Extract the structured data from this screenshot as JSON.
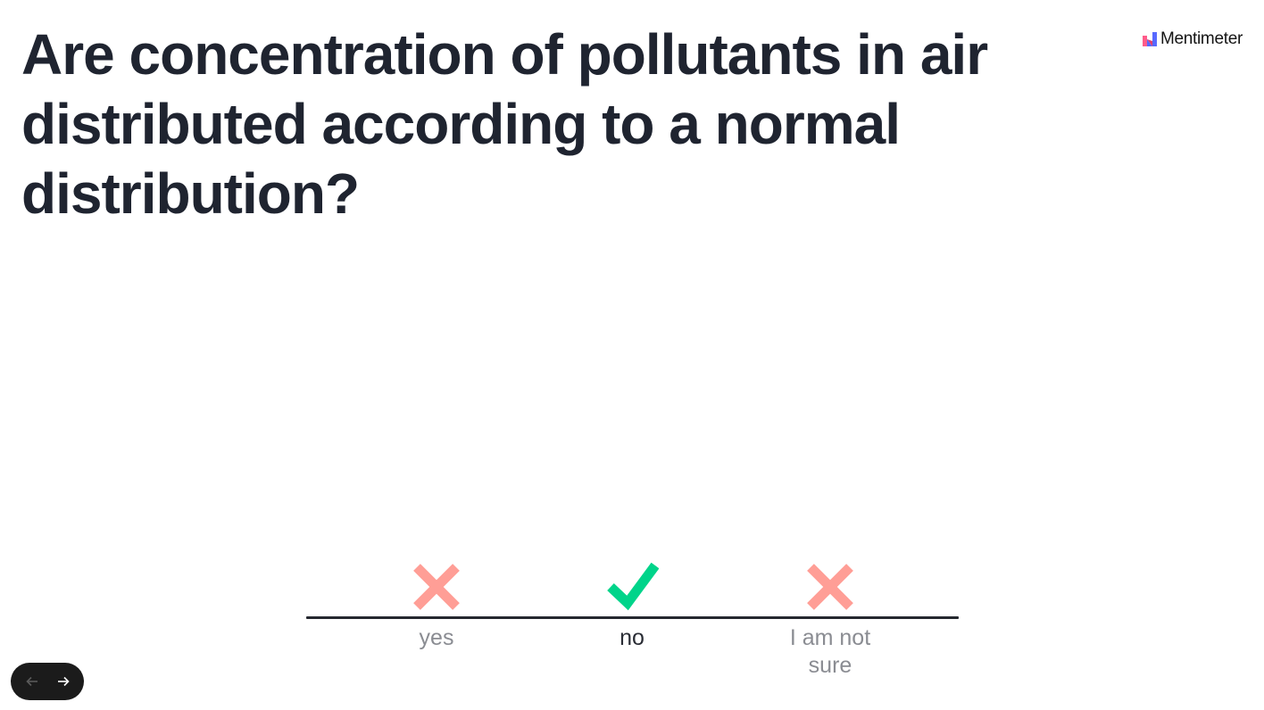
{
  "slide": {
    "question": "Are concentration of pollutants in air distributed according to a normal distribution?"
  },
  "brand": {
    "name": "Mentimeter",
    "colors": [
      "#ff5c8a",
      "#5769ff",
      "#e03e6e"
    ]
  },
  "answers": [
    {
      "label": "yes",
      "correct": false,
      "icon": "cross-icon",
      "color": "#ff9e96"
    },
    {
      "label": "no",
      "correct": true,
      "icon": "checkmark-icon",
      "color": "#00d48a"
    },
    {
      "label": "I am not sure",
      "correct": false,
      "icon": "cross-icon",
      "color": "#ff9e96"
    }
  ],
  "navigation": {
    "previous_icon": "arrow-left-icon",
    "next_icon": "arrow-right-icon",
    "previous_enabled": false,
    "next_enabled": true
  },
  "colors": {
    "text": "#1f2430",
    "baseline": "#25282f",
    "muted_label": "#8a8c92",
    "nav_background": "#1b1b1b"
  }
}
